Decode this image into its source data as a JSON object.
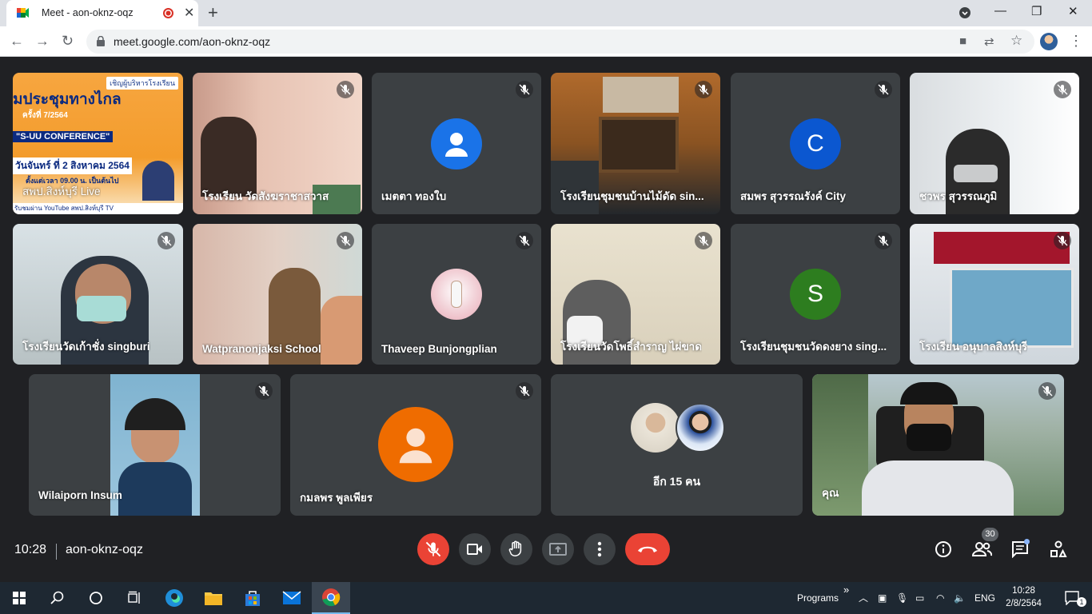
{
  "browser": {
    "tab_title": "Meet - aon-oknz-oqz",
    "url": "meet.google.com/aon-oknz-oqz"
  },
  "tiles": [
    {
      "name": "สพป.สิงห์บุรี Live"
    },
    {
      "name": "โรงเรียน วัดสังฆราชาสวาส"
    },
    {
      "name": "เมตตา ทองใบ"
    },
    {
      "name": "โรงเรียนชุมชนบ้านไม้ดัด sin..."
    },
    {
      "name": "สมพร สุวรรณรังค์ City",
      "initial": "C"
    },
    {
      "name": "ชวพร สุวรรณภูมิ"
    },
    {
      "name": "โรงเรียนวัดเก้าชั่ง singburi"
    },
    {
      "name": "Watpranonjaksi School"
    },
    {
      "name": "Thaveep Bunjongplian"
    },
    {
      "name": "โรงเรียนวัดโพธิ์สำราญ ไผ่ขาด"
    },
    {
      "name": "โรงเรียนชุมชนวัดดงยาง sing...",
      "initial": "S"
    },
    {
      "name": "โรงเรียน อนุบาลสิงห์บุรี"
    },
    {
      "name": "Wilaiporn Insum"
    },
    {
      "name": "กมลพร พูลเพียร"
    },
    {
      "name": "อีก 15 คน"
    },
    {
      "name": "คุณ"
    }
  ],
  "slide": {
    "tag": "เชิญผู้บริหารโรงเรียน",
    "title": "มประชุมทางไกล",
    "round": "ครั้งที่ 7/2564",
    "conf": "\"S-UU CONFERENCE\"",
    "date": "วันจันทร์ ที่ 2 สิงหาคม 2564",
    "time": "ตั้งแต่เวลา 09.00 น. เป็นต้นไป",
    "footer": "รับชมผ่าน YouTube สพป.สิงห์บุรี TV"
  },
  "meeting": {
    "time": "10:28",
    "code": "aon-oknz-oqz",
    "participants": "30"
  },
  "taskbar": {
    "programs": "Programs",
    "lang": "ENG",
    "time": "10:28",
    "date": "2/8/2564",
    "notif": "1"
  },
  "colors": {
    "bg": "#202124",
    "tile": "#3c4043",
    "red": "#ea4335",
    "blue_avatar": "#1a73e8",
    "c_avatar": "#0b57d0",
    "s_avatar": "#2d7d1f",
    "orange_avatar": "#ef6c00"
  }
}
